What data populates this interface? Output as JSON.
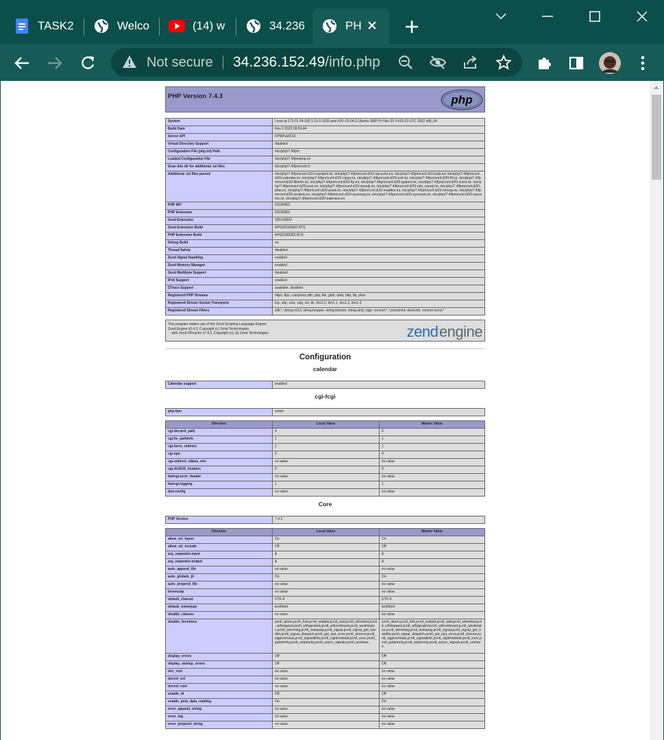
{
  "browser": {
    "tabs": [
      {
        "title": "TASK2",
        "icon": "google-docs-icon"
      },
      {
        "title": "Welco",
        "icon": "globe-icon"
      },
      {
        "title": "(14) w",
        "icon": "youtube-icon"
      },
      {
        "title": "34.236",
        "icon": "globe-icon"
      },
      {
        "title": "PH",
        "icon": "globe-icon",
        "active": true
      }
    ],
    "omnibox": {
      "security_label": "Not secure",
      "url_host": "34.236.152.49",
      "url_path": "/info.php"
    },
    "colors": {
      "frame": "#0b4f4a",
      "toolbar": "#175b56",
      "omnibox": "#0b4541"
    }
  },
  "phpinfo": {
    "title": "PHP Version 7.4.3",
    "logo_text": "php",
    "system_rows": [
      {
        "k": "System",
        "v": "Linux ip-172-31-24-182 5.15.0-1026-aws #30~20.04.2-Ubuntu SMP Fri Nov 25 14:53:22 UTC 2022 x86_64"
      },
      {
        "k": "Build Date",
        "v": "Nov 2 2022 09:53:44"
      },
      {
        "k": "Server API",
        "v": "FPM/FastCGI"
      },
      {
        "k": "Virtual Directory Support",
        "v": "disabled"
      },
      {
        "k": "Configuration File (php.ini) Path",
        "v": "/etc/php/7.4/fpm"
      },
      {
        "k": "Loaded Configuration File",
        "v": "/etc/php/7.4/fpm/php.ini"
      },
      {
        "k": "Scan this dir for additional .ini files",
        "v": "/etc/php/7.4/fpm/conf.d"
      },
      {
        "k": "Additional .ini files parsed",
        "v": "/etc/php/7.4/fpm/conf.d/10-mysqlnd.ini, /etc/php/7.4/fpm/conf.d/10-opcache.ini, /etc/php/7.4/fpm/conf.d/10-pdo.ini, /etc/php/7.4/fpm/conf.d/20-calendar.ini, /etc/php/7.4/fpm/conf.d/20-ctype.ini, /etc/php/7.4/fpm/conf.d/20-exif.ini, /etc/php/7.4/fpm/conf.d/20-ffi.ini, /etc/php/7.4/fpm/conf.d/20-fileinfo.ini, /etc/php/7.4/fpm/conf.d/20-ftp.ini, /etc/php/7.4/fpm/conf.d/20-gettext.ini, /etc/php/7.4/fpm/conf.d/20-iconv.ini, /etc/php/7.4/fpm/conf.d/20-json.ini, /etc/php/7.4/fpm/conf.d/20-mysqli.ini, /etc/php/7.4/fpm/conf.d/20-pdo_mysql.ini, /etc/php/7.4/fpm/conf.d/20-phar.ini, /etc/php/7.4/fpm/conf.d/20-posix.ini, /etc/php/7.4/fpm/conf.d/20-readline.ini, /etc/php/7.4/fpm/conf.d/20-shmop.ini, /etc/php/7.4/fpm/conf.d/20-sockets.ini, /etc/php/7.4/fpm/conf.d/20-sysvmsg.ini, /etc/php/7.4/fpm/conf.d/20-sysvsem.ini, /etc/php/7.4/fpm/conf.d/20-sysvshm.ini, /etc/php/7.4/fpm/conf.d/20-tokenizer.ini",
        "tall": true
      },
      {
        "k": "PHP API",
        "v": "20190902"
      },
      {
        "k": "PHP Extension",
        "v": "20190902"
      },
      {
        "k": "Zend Extension",
        "v": "320190902"
      },
      {
        "k": "Zend Extension Build",
        "v": "API320190902,NTS"
      },
      {
        "k": "PHP Extension Build",
        "v": "API20190902,NTS"
      },
      {
        "k": "Debug Build",
        "v": "no"
      },
      {
        "k": "Thread Safety",
        "v": "disabled"
      },
      {
        "k": "Zend Signal Handling",
        "v": "enabled"
      },
      {
        "k": "Zend Memory Manager",
        "v": "enabled"
      },
      {
        "k": "Zend Multibyte Support",
        "v": "disabled"
      },
      {
        "k": "IPv6 Support",
        "v": "enabled"
      },
      {
        "k": "DTrace Support",
        "v": "available, disabled"
      },
      {
        "k": "Registered PHP Streams",
        "v": "https, ftps, compress.zlib, php, file, glob, data, http, ftp, phar"
      },
      {
        "k": "Registered Stream Socket Transports",
        "v": "tcp, udp, unix, udg, ssl, tls, tlsv1.0, tlsv1.1, tlsv1.2, tlsv1.3"
      },
      {
        "k": "Registered Stream Filters",
        "v": "zlib.*, string.rot13, string.toupper, string.tolower, string.strip_tags, convert.*, consumed, dechunk, convert.iconv.*"
      }
    ],
    "zend": {
      "lines": [
        "This program makes use of the Zend Scripting Language Engine:",
        "Zend Engine v3.4.0, Copyright (c) Zend Technologies",
        "    with Zend OPcache v7.4.3, Copyright (c), by Zend Technologies"
      ],
      "logo_zend": "zend",
      "logo_engine": "engine"
    },
    "configuration_heading": "Configuration",
    "calendar": {
      "heading": "calendar",
      "rows": [
        {
          "k": "Calendar support",
          "v": "enabled"
        }
      ]
    },
    "cgi_fcgi": {
      "heading": "cgi-fcgi",
      "rows": [
        {
          "k": "php-fpm",
          "v": "active"
        }
      ],
      "directive_headers": [
        "Directive",
        "Local Value",
        "Master Value"
      ],
      "directives": [
        {
          "k": "cgi.discard_path",
          "l": "0",
          "m": "0"
        },
        {
          "k": "cgi.fix_pathinfo",
          "l": "1",
          "m": "1"
        },
        {
          "k": "cgi.force_redirect",
          "l": "1",
          "m": "1"
        },
        {
          "k": "cgi.nph",
          "l": "0",
          "m": "0"
        },
        {
          "k": "cgi.redirect_status_env",
          "l": "no value",
          "m": "no value"
        },
        {
          "k": "cgi.rfc2616_headers",
          "l": "0",
          "m": "0"
        },
        {
          "k": "fastcgi.error_header",
          "l": "no value",
          "m": "no value"
        },
        {
          "k": "fastcgi.logging",
          "l": "1",
          "m": "1"
        },
        {
          "k": "fpm.config",
          "l": "no value",
          "m": "no value"
        }
      ]
    },
    "core": {
      "heading": "Core",
      "rows": [
        {
          "k": "PHP Version",
          "v": "7.4.3"
        }
      ],
      "directive_headers": [
        "Directive",
        "Local Value",
        "Master Value"
      ],
      "directives": [
        {
          "k": "allow_url_fopen",
          "l": "On",
          "m": "On"
        },
        {
          "k": "allow_url_include",
          "l": "Off",
          "m": "Off"
        },
        {
          "k": "arg_separator.input",
          "l": "&",
          "m": "&"
        },
        {
          "k": "arg_separator.output",
          "l": "&",
          "m": "&"
        },
        {
          "k": "auto_append_file",
          "l": "no value",
          "m": "no value"
        },
        {
          "k": "auto_globals_jit",
          "l": "On",
          "m": "On"
        },
        {
          "k": "auto_prepend_file",
          "l": "no value",
          "m": "no value"
        },
        {
          "k": "browscap",
          "l": "no value",
          "m": "no value"
        },
        {
          "k": "default_charset",
          "l": "UTF-8",
          "m": "UTF-8"
        },
        {
          "k": "default_mimetype",
          "l": "text/html",
          "m": "text/html"
        },
        {
          "k": "disable_classes",
          "l": "no value",
          "m": "no value"
        },
        {
          "k": "disable_functions",
          "l": "pcntl_alarm,pcntl_fork,pcntl_waitpid,pcntl_wait,pcntl_wifexited,pcntl_wifstopped,pcntl_wifsignaled,pcntl_wifcontinued,pcntl_wexitstatus,pcntl_wtermsig,pcntl_wstopsig,pcntl_signal,pcntl_signal_get_handler,pcntl_signal_dispatch,pcntl_get_last_error,pcntl_strerror,pcntl_sigprocmask,pcntl_sigwaitinfo,pcntl_sigtimedwait,pcntl_exec,pcntl_getpriority,pcntl_setpriority,pcntl_async_signals,pcntl_unshare,",
          "m": "pcntl_alarm,pcntl_fork,pcntl_waitpid,pcntl_wait,pcntl_wifexited,pcntl_wifstopped,pcntl_wifsignaled,pcntl_wifcontinued,pcntl_wexitstatus,pcntl_wtermsig,pcntl_wstopsig,pcntl_signal,pcntl_signal_get_handler,pcntl_signal_dispatch,pcntl_get_last_error,pcntl_strerror,pcntl_sigprocmask,pcntl_sigwaitinfo,pcntl_sigtimedwait,pcntl_exec,pcntl_getpriority,pcntl_setpriority,pcntl_async_signals,pcntl_unshare,",
          "tall": true
        },
        {
          "k": "display_errors",
          "l": "Off",
          "m": "Off"
        },
        {
          "k": "display_startup_errors",
          "l": "Off",
          "m": "Off"
        },
        {
          "k": "doc_root",
          "l": "no value",
          "m": "no value"
        },
        {
          "k": "docref_ext",
          "l": "no value",
          "m": "no value"
        },
        {
          "k": "docref_root",
          "l": "no value",
          "m": "no value"
        },
        {
          "k": "enable_dl",
          "l": "Off",
          "m": "Off"
        },
        {
          "k": "enable_post_data_reading",
          "l": "On",
          "m": "On"
        },
        {
          "k": "error_append_string",
          "l": "no value",
          "m": "no value"
        },
        {
          "k": "error_log",
          "l": "no value",
          "m": "no value"
        },
        {
          "k": "error_prepend_string",
          "l": "no value",
          "m": "no value"
        }
      ]
    }
  }
}
